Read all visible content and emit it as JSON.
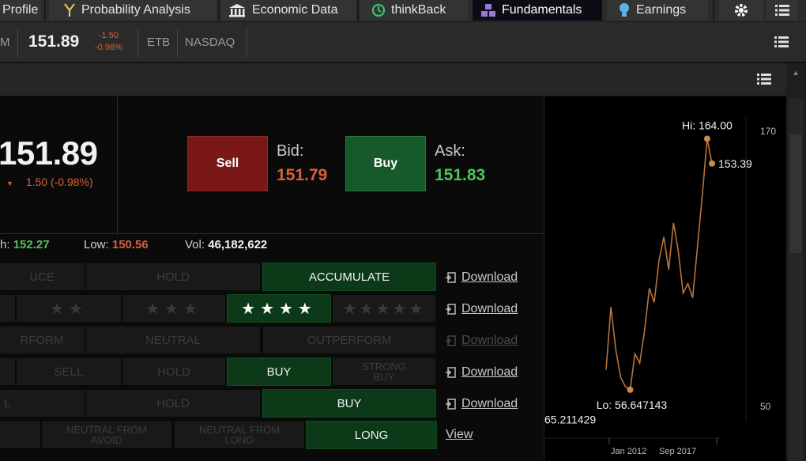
{
  "tabs": [
    {
      "label": "Profile",
      "icon": "profile-icon"
    },
    {
      "label": "Probability Analysis",
      "icon": "probability-icon"
    },
    {
      "label": "Economic Data",
      "icon": "bank-icon"
    },
    {
      "label": "thinkBack",
      "icon": "refresh-icon"
    },
    {
      "label": "Fundamentals",
      "icon": "fundamentals-icon",
      "active": true
    },
    {
      "label": "Earnings",
      "icon": "lightbulb-icon"
    }
  ],
  "quote": {
    "price": "151.89",
    "change": "-1.50",
    "change_pct": "-0.98%",
    "etb": "ETB",
    "exchange": "NASDAQ",
    "left_fragment": "M"
  },
  "summary": {
    "last": "151.89",
    "change_line": "1.50 (-0.98%)",
    "sell_label": "Sell",
    "buy_label": "Buy",
    "bid_label": "Bid:",
    "bid": "151.79",
    "ask_label": "Ask:",
    "ask": "151.83",
    "high_label": "h:",
    "high": "152.27",
    "low_label": "Low:",
    "low": "150.56",
    "vol_label": "Vol:",
    "vol": "46,182,622"
  },
  "ratings": {
    "row1": [
      "UCE",
      "HOLD",
      "ACCUMULATE"
    ],
    "row2": [
      "★★",
      "★★★",
      "★★★★",
      "★★★★★"
    ],
    "row3": [
      "RFORM",
      "NEUTRAL",
      "OUTPERFORM"
    ],
    "row4": [
      "SELL",
      "HOLD",
      "BUY",
      "STRONG BUY"
    ],
    "row5": [
      "L",
      "HOLD",
      "BUY"
    ],
    "row6": [
      "NEUTRAL FROM AVOID",
      "NEUTRAL FROM LONG",
      "LONG"
    ],
    "actions": [
      "Download",
      "Download",
      "Download",
      "Download",
      "Download",
      "View"
    ]
  },
  "chart_data": {
    "type": "line",
    "hi_label": "Hi: 164.00",
    "lo_label": "Lo: 56.647143",
    "last_label": "153.39",
    "start_label": "65.211429",
    "ytick_top": "170",
    "ytick_bottom": "50",
    "xticks": [
      "Jan 2012",
      "Sep 2017"
    ],
    "ylim": [
      40,
      176
    ],
    "x": [
      0,
      3,
      6,
      9,
      12,
      15,
      18,
      21,
      24,
      27,
      30,
      33,
      36,
      39,
      42,
      45,
      48,
      51,
      54,
      57,
      60,
      63,
      66
    ],
    "values": [
      65.2,
      92,
      74,
      62,
      58,
      56.6,
      72,
      68,
      82,
      100,
      94,
      112,
      122,
      108,
      128,
      116,
      98,
      102,
      96,
      118,
      140,
      164,
      153.4
    ],
    "color": "#b8743a"
  },
  "colors": {
    "red": "#d8603a",
    "green": "#4fc35a",
    "sell_bg": "#7a1717",
    "buy_bg": "#175a2a"
  }
}
